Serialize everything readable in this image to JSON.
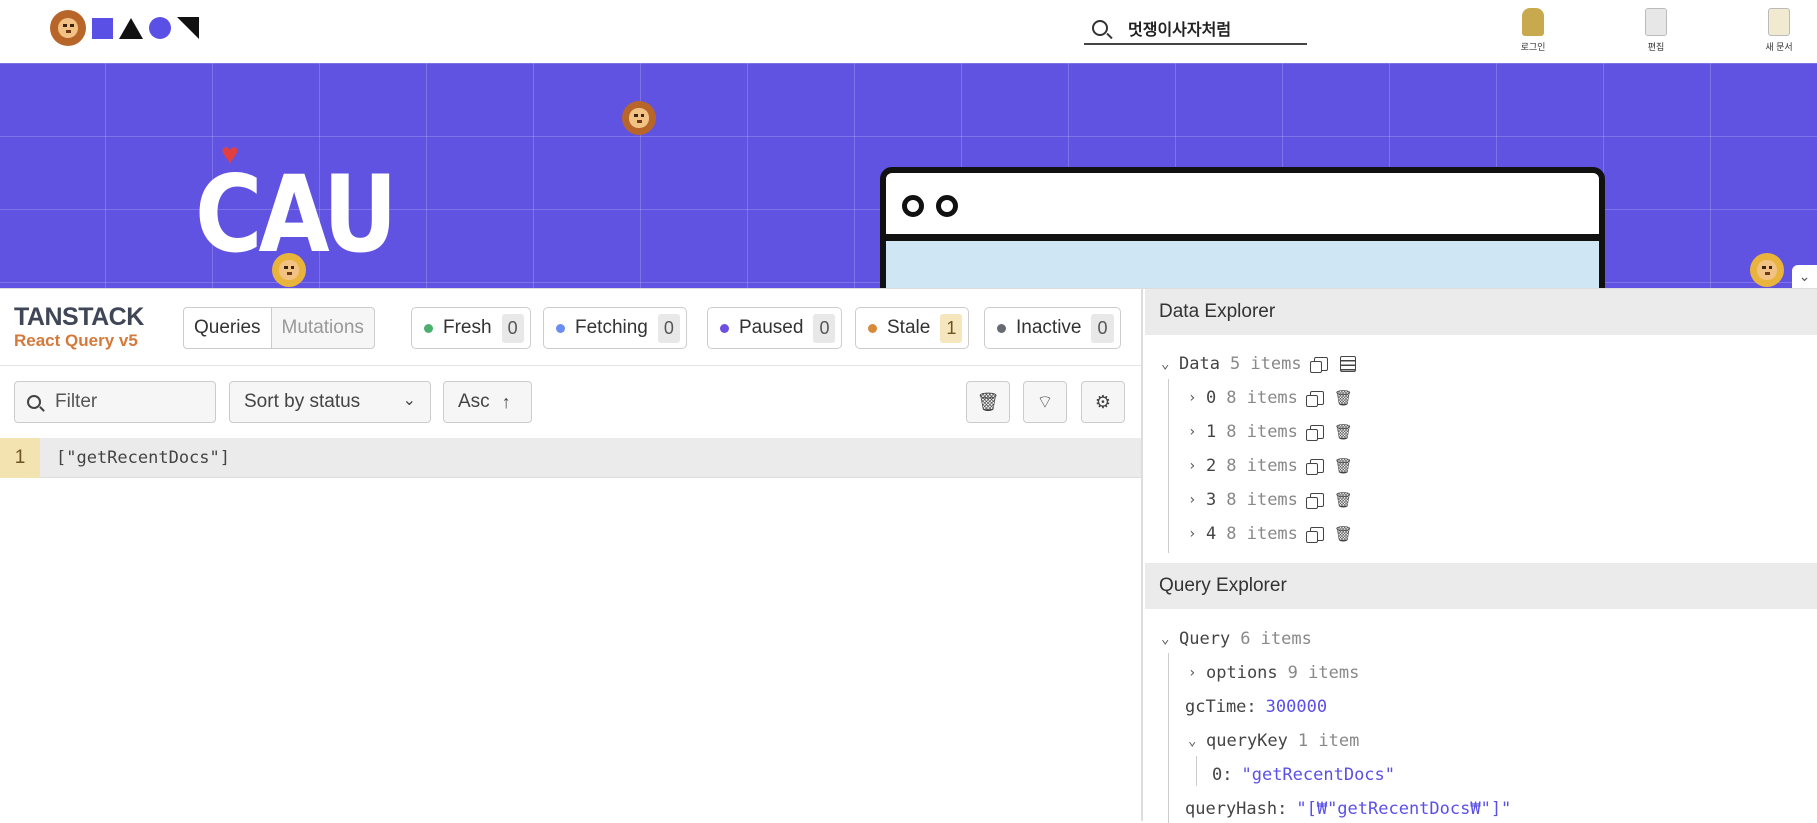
{
  "site": {
    "search_text": "멋쟁이사자처럼",
    "tools": [
      {
        "label": "로그인"
      },
      {
        "label": "편집"
      },
      {
        "label": "새 문서"
      }
    ]
  },
  "hero": {
    "logo_text": "CAU"
  },
  "devtools": {
    "brand_top": "TANSTACK",
    "brand_bottom": "React Query v5",
    "tabs": {
      "queries": "Queries",
      "mutations": "Mutations"
    },
    "status_badges": [
      {
        "label": "Fresh",
        "count": "0",
        "color": "#4caf6e"
      },
      {
        "label": "Fetching",
        "count": "0",
        "color": "#6b8df0"
      },
      {
        "label": "Paused",
        "count": "0",
        "color": "#6e4fe0"
      },
      {
        "label": "Stale",
        "count": "1",
        "color": "#d88a3a"
      },
      {
        "label": "Inactive",
        "count": "0",
        "color": "#666a73"
      }
    ],
    "filter_placeholder": "Filter",
    "sort_label": "Sort by status",
    "order_label": "Asc",
    "query_rows": [
      {
        "index": "1",
        "key": "[\"getRecentDocs\"]"
      }
    ],
    "data_explorer": {
      "title": "Data Explorer",
      "root_label": "Data",
      "root_count": "5 items",
      "children": [
        {
          "key": "0",
          "count": "8 items"
        },
        {
          "key": "1",
          "count": "8 items"
        },
        {
          "key": "2",
          "count": "8 items"
        },
        {
          "key": "3",
          "count": "8 items"
        },
        {
          "key": "4",
          "count": "8 items"
        }
      ]
    },
    "query_explorer": {
      "title": "Query Explorer",
      "root_label": "Query",
      "root_count": "6 items",
      "options_label": "options",
      "options_count": "9 items",
      "gc_label": "gcTime:",
      "gc_value": "300000",
      "querykey_label": "queryKey",
      "querykey_count": "1 item",
      "querykey_item_label": "0:",
      "querykey_item_value": "\"getRecentDocs\"",
      "hash_label": "queryHash:",
      "hash_value": "\"[₩\"getRecentDocs₩\"]\""
    }
  }
}
